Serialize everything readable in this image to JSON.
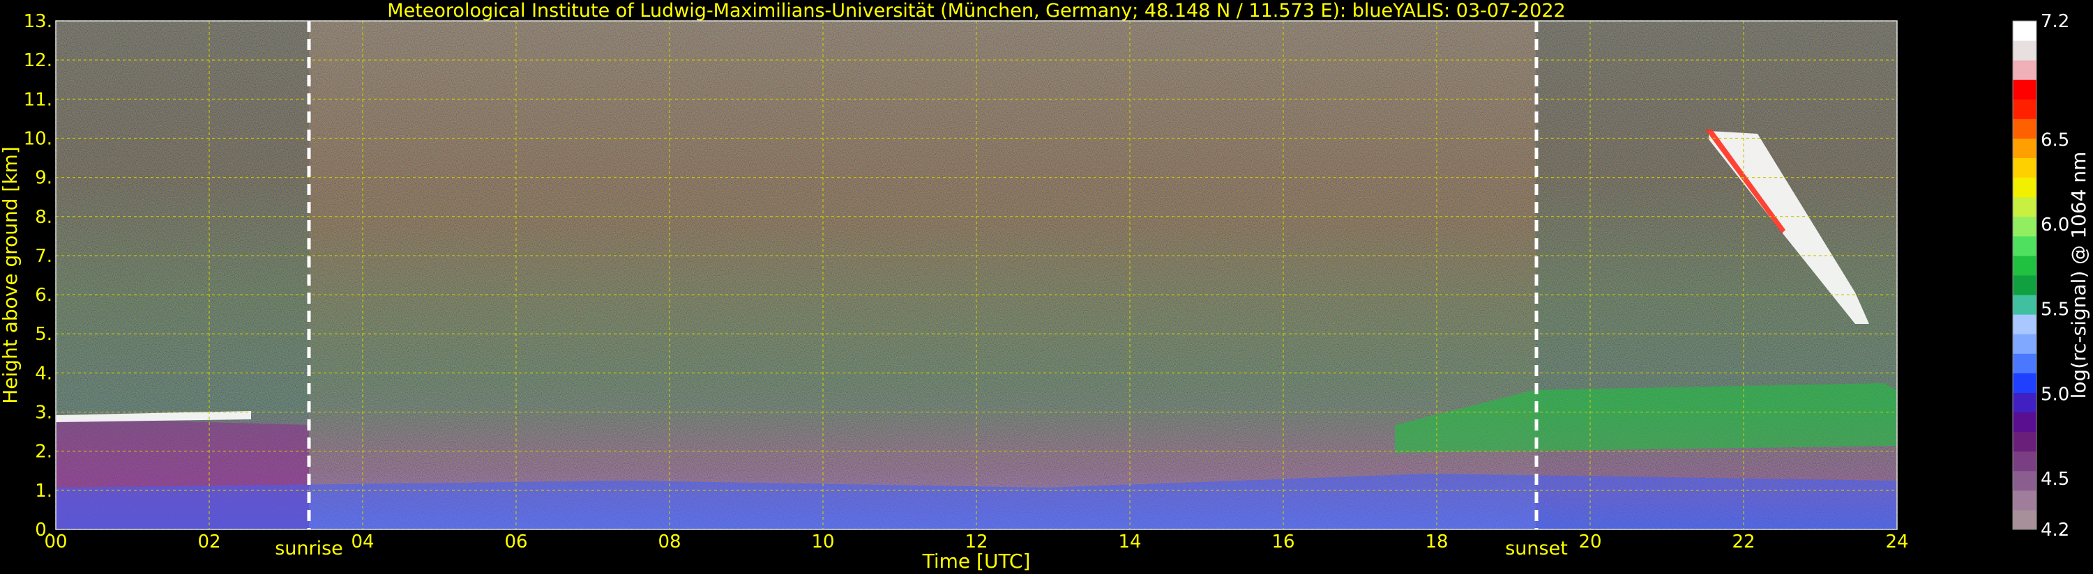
{
  "chart_data": {
    "type": "heatmap",
    "title": "Meteorological Institute of Ludwig-Maximilians-Universität (München, Germany; 48.148 N / 11.573 E):    blueYALIS: 03-07-2022",
    "xlabel": "Time [UTC]",
    "ylabel": "Height above ground [km]",
    "xlim": [
      0,
      24
    ],
    "ylim": [
      0,
      13
    ],
    "x_ticks": [
      "00",
      "02",
      "04",
      "06",
      "08",
      "10",
      "12",
      "14",
      "16",
      "18",
      "20",
      "22",
      "24"
    ],
    "y_ticks": [
      "0.",
      "1.",
      "2.",
      "3.",
      "4.",
      "5.",
      "6.",
      "7.",
      "8.",
      "9.",
      "10.",
      "11.",
      "12.",
      "13."
    ],
    "grid": true,
    "markers": [
      {
        "label": "sunrise",
        "x": 3.3
      },
      {
        "label": "sunset",
        "x": 19.3
      }
    ],
    "colorbar": {
      "label": "log(rc-signal) @ 1064 nm",
      "range": [
        4.2,
        7.2
      ],
      "ticks": [
        "4.2",
        "4.5",
        "5.0",
        "5.5",
        "6.0",
        "6.5",
        "7.2"
      ],
      "colors": [
        "#a8909a",
        "#a07e9b",
        "#8a5f8f",
        "#7a3f83",
        "#6a1f7a",
        "#5a0f90",
        "#4020c0",
        "#2040ff",
        "#4a78ff",
        "#80a8ff",
        "#a8c8ff",
        "#40c0a0",
        "#10a040",
        "#20c040",
        "#50e060",
        "#90ee60",
        "#c8f040",
        "#f0f000",
        "#ffd000",
        "#ffa000",
        "#ff6000",
        "#ff2000",
        "#ff0000",
        "#f0b0b8",
        "#e8e0e0",
        "#ffffff"
      ]
    }
  }
}
